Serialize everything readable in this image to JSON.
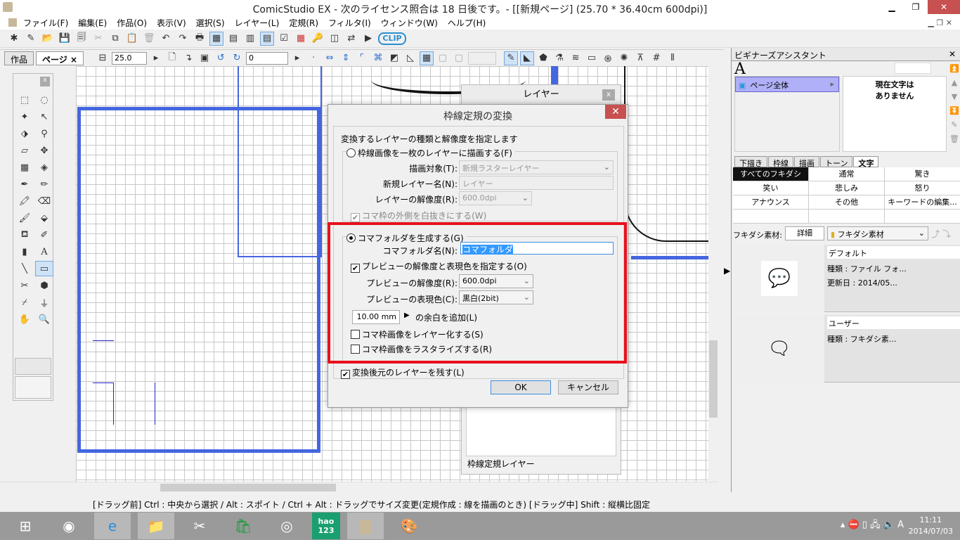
{
  "window": {
    "title": "ComicStudio EX  - 次のライセンス照合は 18 日後です。- [[新規ページ] (25.70 * 36.40cm 600dpi)]"
  },
  "menu": [
    "ファイル(F)",
    "編集(E)",
    "作品(O)",
    "表示(V)",
    "選択(S)",
    "レイヤー(L)",
    "定規(R)",
    "フィルタ(I)",
    "ウィンドウ(W)",
    "ヘルプ(H)"
  ],
  "toolbar2": {
    "tab_work": "作品",
    "tab_page": "ページ",
    "close": "×",
    "zoom_value": "25.0",
    "rotate_value": "0"
  },
  "layer_panel": {
    "title": "レイヤー",
    "close": "x",
    "bottom_label": "枠線定規レイヤー"
  },
  "dialog": {
    "title": "枠線定規の変換",
    "close": "✕",
    "instruction": "変換するレイヤーの種類と解像度を指定します",
    "opt1": {
      "label": "枠線画像を一枚のレイヤーに描画する(F)",
      "selected": false,
      "target_label": "描画対象(T):",
      "target_value": "新規ラスターレイヤー",
      "name_label": "新規レイヤー名(N):",
      "name_value": "レイヤー",
      "res_label": "レイヤーの解像度(R):",
      "res_value": "600.0dpi",
      "whiteout_label": "コマ枠の外側を白抜きにする(W)",
      "whiteout_checked": true
    },
    "opt2": {
      "label": "コマフォルダを生成する(G)",
      "selected": true,
      "folder_label": "コマフォルダ名(N):",
      "folder_value": "コマフォルダ",
      "preview_label": "プレビューの解像度と表現色を指定する(O)",
      "preview_checked": true,
      "pres_label": "プレビューの解像度(R):",
      "pres_value": "600.0dpi",
      "pcolor_label": "プレビューの表現色(C):",
      "pcolor_value": "黒白(2bit)",
      "margin_value": "10.00 mm",
      "margin_label": "の余白を追加(L)",
      "layerize_label": "コマ枠画像をレイヤー化する(S)",
      "layerize_checked": false,
      "rasterize_label": "コマ枠画像をラスタライズする(R)",
      "rasterize_checked": false
    },
    "keep_label": "変換後元のレイヤーを残す(L)",
    "keep_checked": true,
    "ok": "OK",
    "cancel": "キャンセル"
  },
  "assistant": {
    "title": "ビギナーズアシスタント",
    "close": "✕",
    "font_icon": "A",
    "scope": "ページ全体",
    "no_text": "現在文字は\nありません",
    "tabs": [
      "下描き",
      "枠線",
      "描画",
      "トーン",
      "文字"
    ],
    "active_tab": 4,
    "keywords": [
      "すべてのフキダシ",
      "通常",
      "驚き",
      "笑い",
      "悲しみ",
      "怒り",
      "アナウンス",
      "その他",
      "キーワードの編集...",
      "",
      "",
      ""
    ],
    "material_label": "フキダシ素材:",
    "view_mode": "詳細",
    "folder": "フキダシ素材",
    "materials": [
      {
        "name": "デフォルト",
        "lines": [
          "種類 : ファイル フォ...",
          "更新日 : 2014/05..."
        ]
      },
      {
        "name": "ユーザー",
        "lines": [
          "種類 : フキダシ素..."
        ]
      }
    ]
  },
  "status": "[ドラッグ前] Ctrl : 中央から選択 / Alt : スポイト / Ctrl + Alt : ドラッグでサイズ変更(定規作成 : 線を描画のとき) [ドラッグ中] Shift : 縦横比固定",
  "taskbar": {
    "time": "11:11",
    "date": "2014/07/03",
    "ime": "A"
  }
}
